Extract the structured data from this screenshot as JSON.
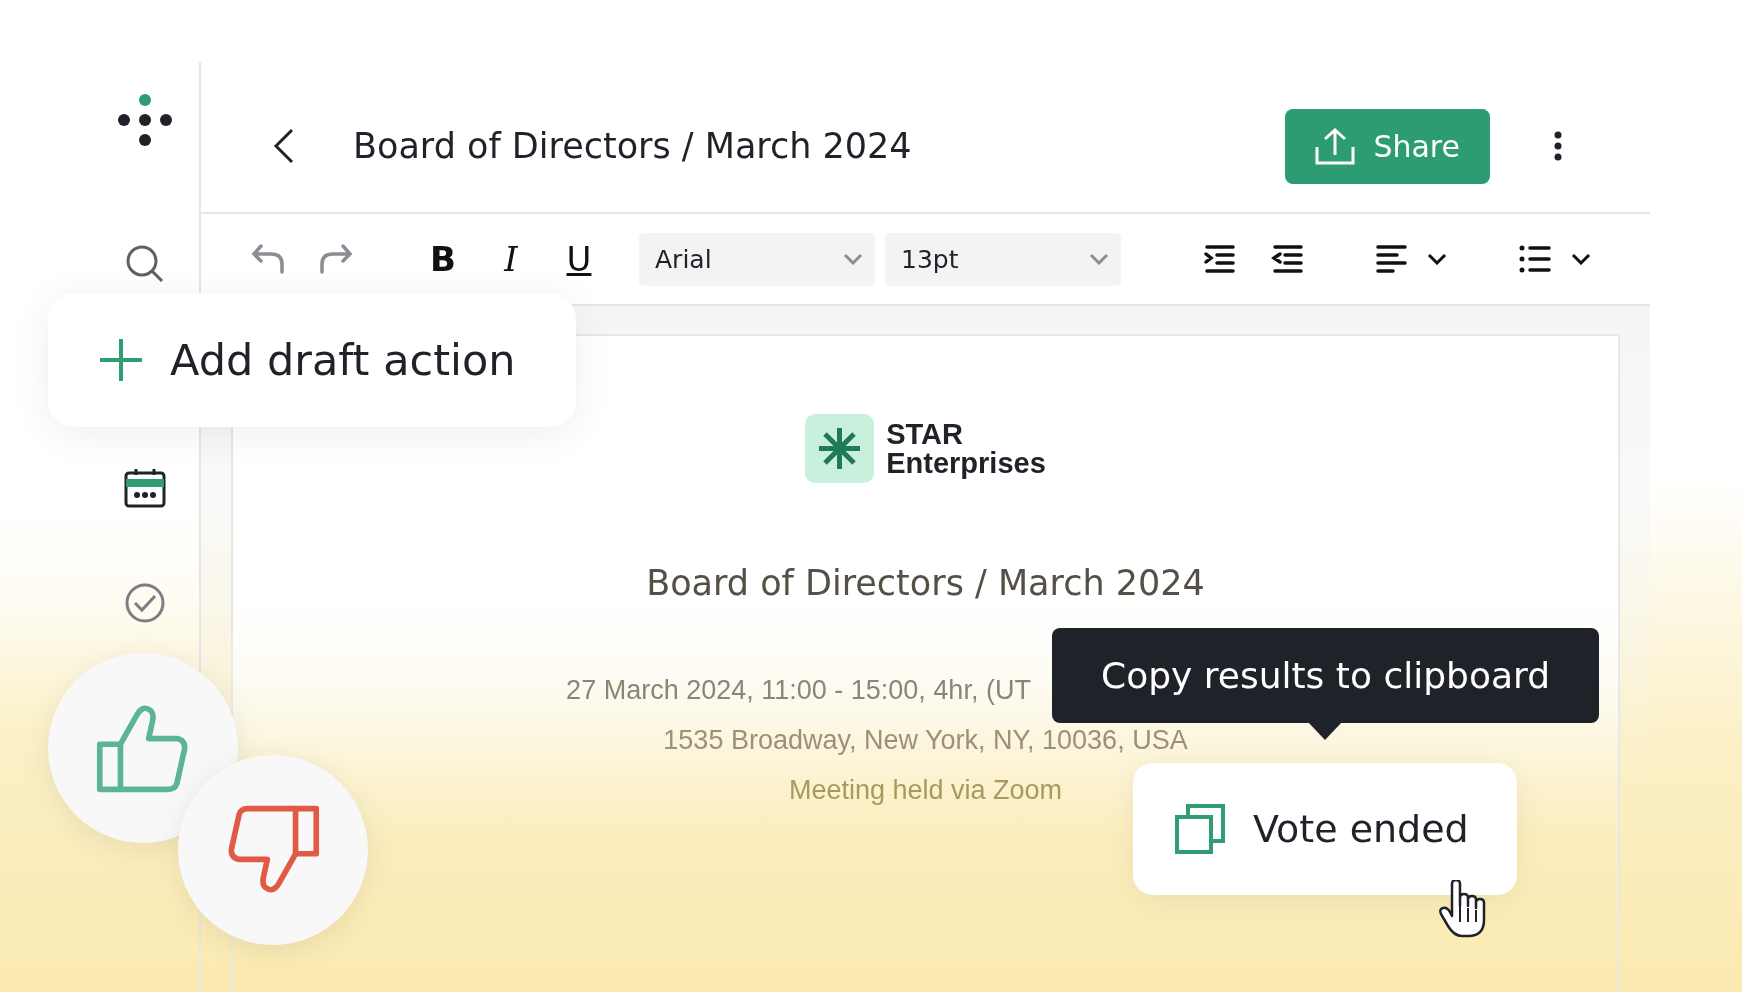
{
  "header": {
    "title": "Board of Directors / March 2024",
    "share_button": "Share"
  },
  "toolbar": {
    "format_buttons": [
      {
        "label": "B",
        "kind": "bold"
      },
      {
        "label": "I",
        "kind": "italic"
      },
      {
        "label": "U",
        "kind": "underline"
      }
    ],
    "font": "Arial",
    "font_size": "13pt"
  },
  "document": {
    "logo": {
      "line1": "STAR",
      "line2": "Enterprises"
    },
    "title": "Board of Directors / March 2024",
    "details": [
      "27 March 2024, 11:00 - 15:00, 4hr, (UT",
      "1535 Broadway, New York, NY, 10036, USA",
      "Meeting held via Zoom"
    ]
  },
  "draft_action": "Add draft action",
  "tooltip": "Copy results to clipboard",
  "vote_card": "Vote ended"
}
